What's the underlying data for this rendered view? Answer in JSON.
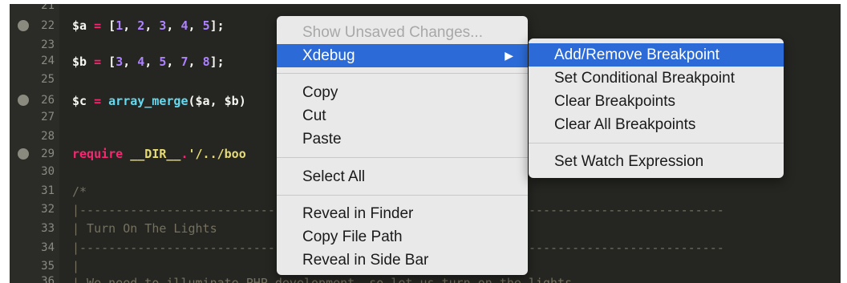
{
  "editor": {
    "line_numbers": [
      "21",
      "22",
      "23",
      "24",
      "25",
      "26",
      "27",
      "28",
      "29",
      "30",
      "31",
      "32",
      "33",
      "34",
      "35",
      "36"
    ],
    "lines": {
      "l22": {
        "var": "$a",
        "eq": " = ",
        "open": "[",
        "n1": "1",
        "c1": ", ",
        "n2": "2",
        "c2": ", ",
        "n3": "3",
        "c3": ", ",
        "n4": "4",
        "c4": ", ",
        "n5": "5",
        "close": "];"
      },
      "l24": {
        "var": "$b",
        "eq": " = ",
        "open": "[",
        "n1": "3",
        "c1": ", ",
        "n2": "4",
        "c2": ", ",
        "n3": "5",
        "c3": ", ",
        "n4": "7",
        "c4": ", ",
        "n5": "8",
        "close": "];"
      },
      "l26": {
        "var": "$c",
        "eq": " = ",
        "fn": "array_merge",
        "args": "($a, $b)"
      },
      "l29": {
        "kw": "require",
        "const": " __DIR__",
        "dot": ".",
        "str": "'/../boo"
      },
      "l31": "/*",
      "l32": "|-----------------------------------------------------------------------------------------",
      "l33": "| Turn On The Lights",
      "l34": "|-----------------------------------------------------------------------------------------",
      "l35": "|",
      "l36": "| We need to illuminate PHP development, so let us turn on the lights"
    }
  },
  "context_menu": {
    "items": [
      {
        "label": "Show Unsaved Changes...",
        "disabled": true
      },
      {
        "label": "Xdebug",
        "submenu_arrow": "▶"
      },
      {
        "label": "Copy"
      },
      {
        "label": "Cut"
      },
      {
        "label": "Paste"
      },
      {
        "label": "Select All"
      },
      {
        "label": "Reveal in Finder"
      },
      {
        "label": "Copy File Path"
      },
      {
        "label": "Reveal in Side Bar"
      }
    ]
  },
  "xdebug_menu": {
    "items": [
      {
        "label": "Add/Remove Breakpoint"
      },
      {
        "label": "Set Conditional Breakpoint"
      },
      {
        "label": "Clear Breakpoints"
      },
      {
        "label": "Clear All Breakpoints"
      },
      {
        "label": "Set Watch Expression"
      }
    ]
  },
  "colors": {
    "editor_bg": "#252622",
    "menu_bg": "#e9e9e9",
    "highlight": "#2c6bd7",
    "breakpoint": "#8a8a7e"
  },
  "icons": [
    "breakpoint-marker-icon",
    "submenu-arrow-icon"
  ]
}
